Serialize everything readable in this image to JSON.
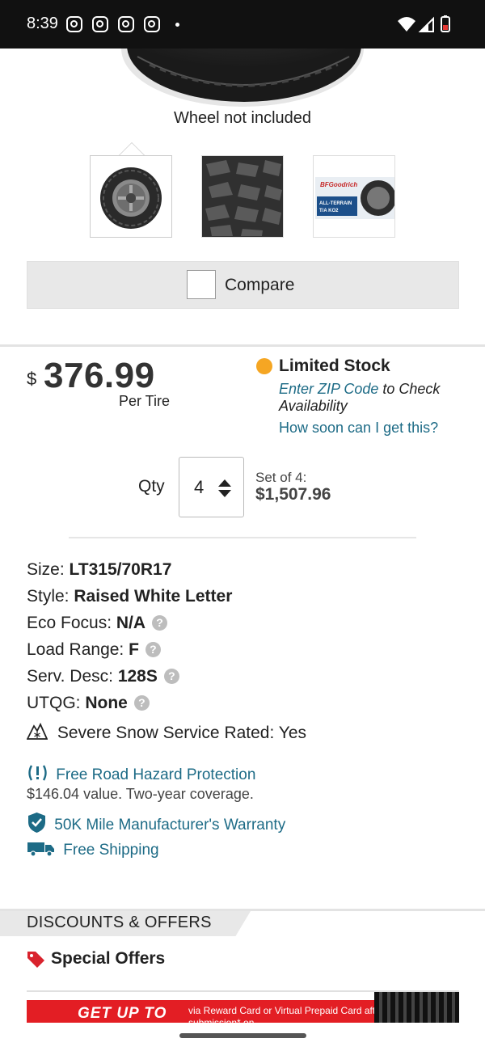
{
  "status_bar": {
    "time": "8:39",
    "notification_icons": [
      "instagram-icon",
      "instagram-icon",
      "instagram-icon",
      "instagram-icon"
    ],
    "right_icons": [
      "wifi-icon",
      "signal-icon",
      "battery-icon"
    ]
  },
  "hero": {
    "caption": "Wheel not included"
  },
  "thumbnails": [
    {
      "name": "tire-side-view",
      "selected": true
    },
    {
      "name": "tread-close-up",
      "selected": false
    },
    {
      "name": "brand-banner",
      "selected": false,
      "text": "BFGoodrich ALL-TERRAIN T/A KO2"
    }
  ],
  "compare": {
    "label": "Compare",
    "checked": false
  },
  "price": {
    "currency": "$",
    "amount": "376.99",
    "unit": "Per Tire"
  },
  "stock": {
    "status": "Limited Stock",
    "status_color": "#f5a623",
    "zip_link": "Enter ZIP Code",
    "zip_text": " to Check Availability",
    "soon_link": "How soon can I get this?"
  },
  "quantity": {
    "label": "Qty",
    "value": "4",
    "set_label": "Set of 4:",
    "set_total": "$1,507.96"
  },
  "specs": [
    {
      "label": "Size: ",
      "value": "LT315/70R17",
      "help": false
    },
    {
      "label": "Style: ",
      "value": "Raised White Letter",
      "help": false
    },
    {
      "label": "Eco Focus: ",
      "value": "N/A",
      "help": true
    },
    {
      "label": "Load Range: ",
      "value": "F",
      "help": true
    },
    {
      "label": "Serv. Desc: ",
      "value": "128S",
      "help": true
    },
    {
      "label": "UTQG: ",
      "value": "None",
      "help": true
    }
  ],
  "snow": {
    "label": "Severe Snow Service Rated: Yes"
  },
  "benefits": {
    "road_hazard": "Free Road Hazard Protection",
    "road_hazard_sub": "$146.04 value. Two-year coverage.",
    "warranty": "50K Mile Manufacturer's Warranty",
    "shipping": "Free Shipping",
    "accent_color": "#1d6b86"
  },
  "discounts": {
    "section_title": "DISCOUNTS & OFFERS",
    "special_offers": "Special Offers",
    "promo_headline": "GET UP TO",
    "promo_text": "via Reward Card or Virtual Prepaid Card after online submission* on"
  }
}
